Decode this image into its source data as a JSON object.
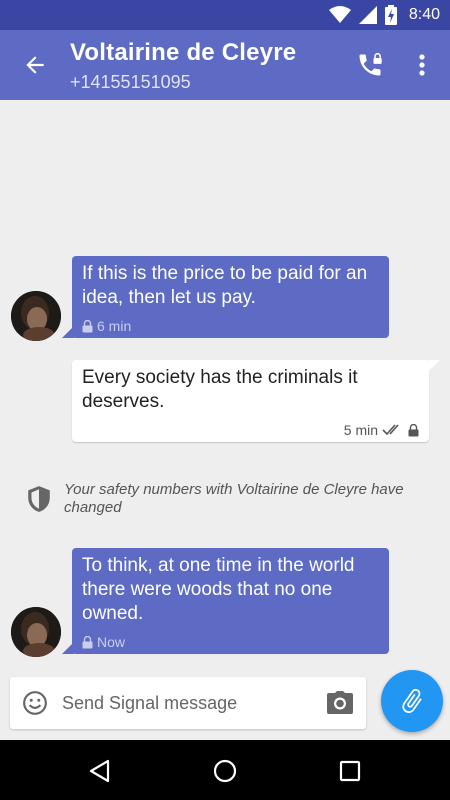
{
  "status_bar": {
    "time": "8:40",
    "icons": [
      "wifi-icon",
      "signal-icon",
      "battery-charging-icon"
    ]
  },
  "header": {
    "title": "Voltairine de Cleyre",
    "subtitle": "+14155151095",
    "icons": [
      "back-arrow-icon",
      "secure-call-icon",
      "more-vert-icon"
    ]
  },
  "messages": [
    {
      "direction": "incoming",
      "text": "If this is the price to be paid for an idea, then let us pay.",
      "time": "6 min"
    },
    {
      "direction": "outgoing",
      "text": "Every society has the criminals it deserves.",
      "time": "5 min"
    },
    {
      "direction": "incoming",
      "text": "To think, at one time in the world there were woods that no one owned.",
      "time": "Now"
    }
  ],
  "safety_notice": {
    "text": "Your safety numbers with Voltairine de Cleyre have changed"
  },
  "composer": {
    "placeholder": "Send Signal message"
  },
  "colors": {
    "primary": "#5d6bc4",
    "primary_dark": "#3a46a3",
    "fab": "#2196f3",
    "background": "#eeeeee"
  }
}
